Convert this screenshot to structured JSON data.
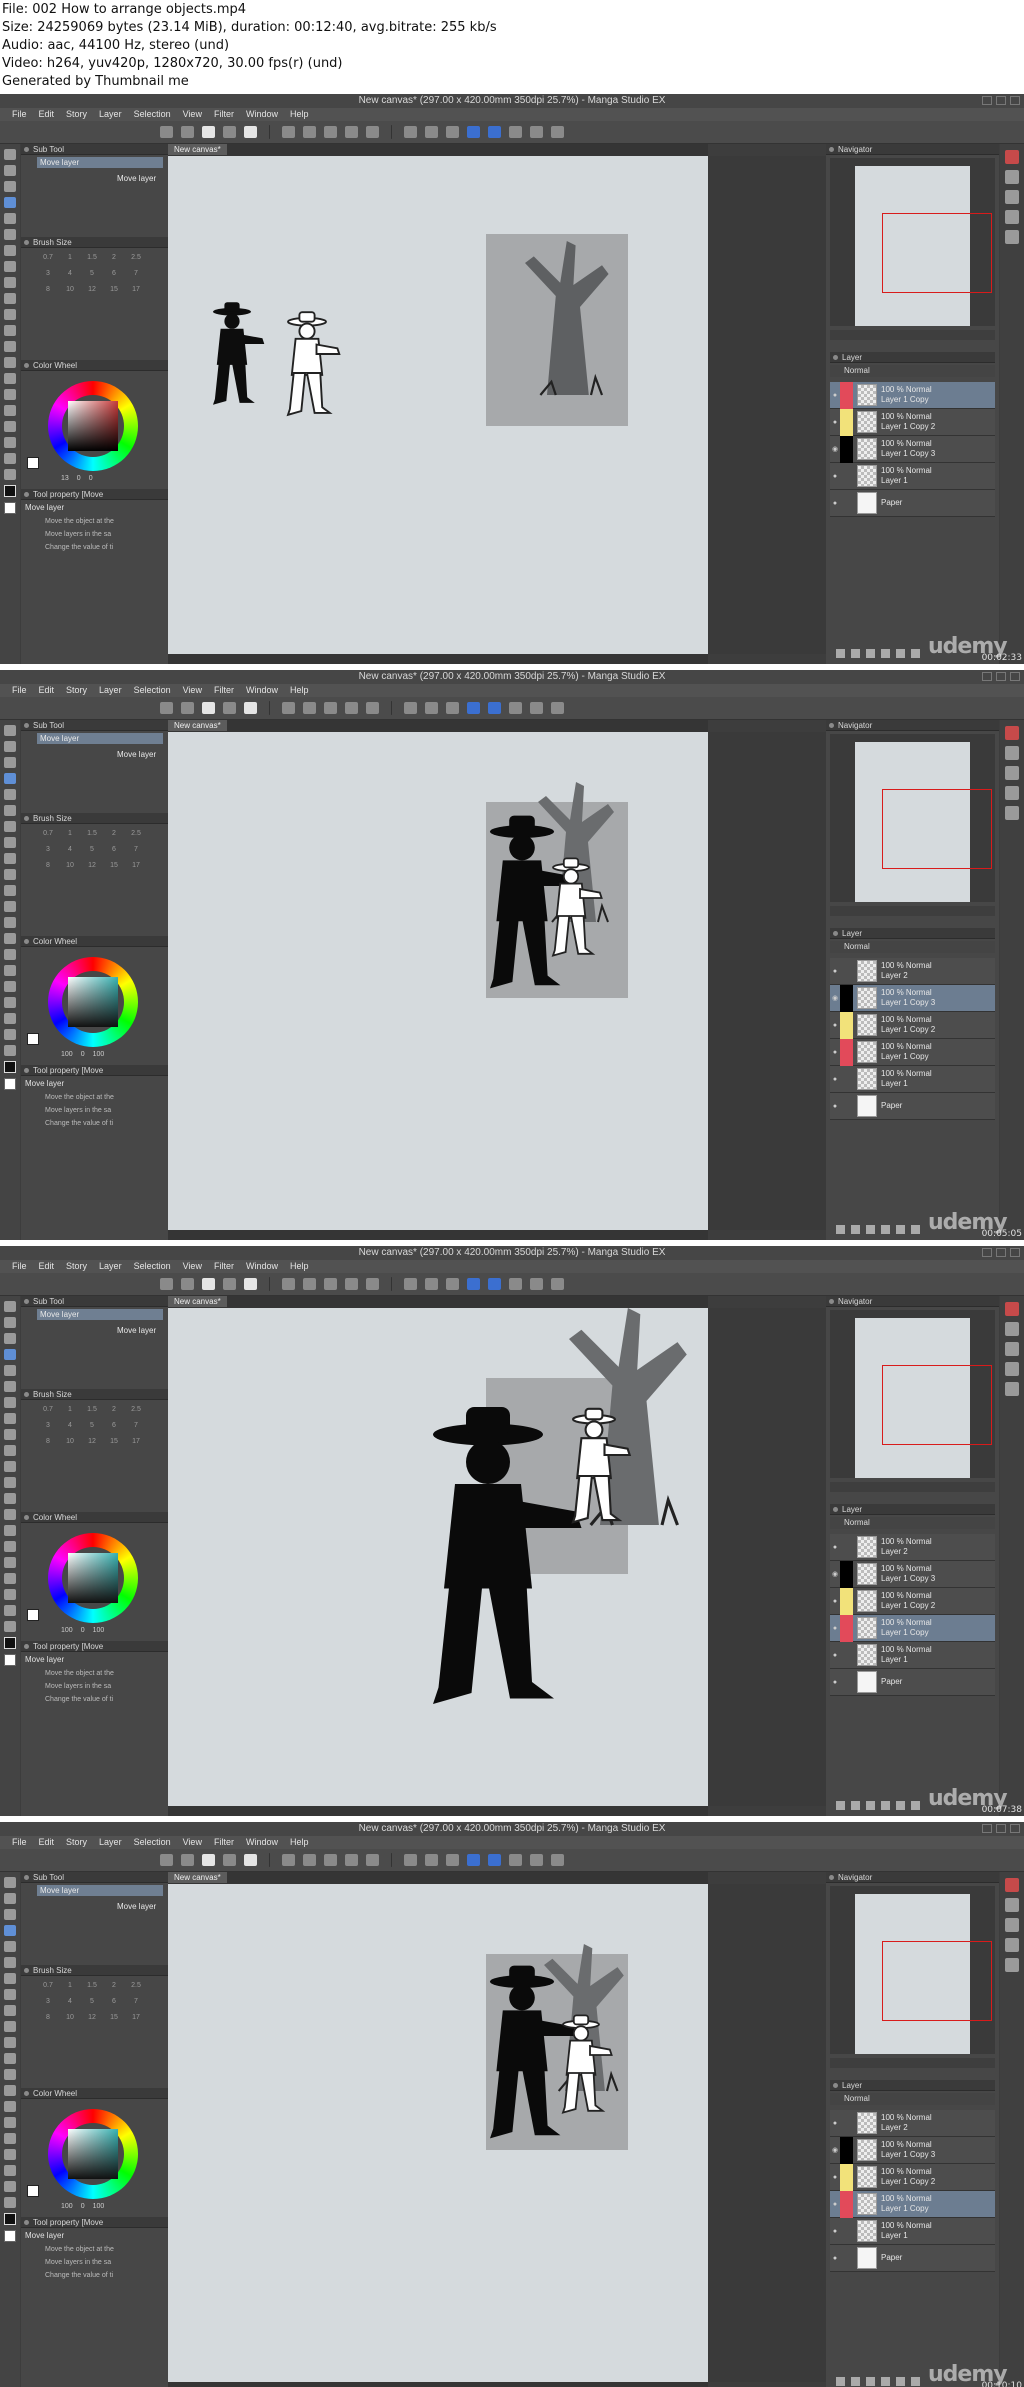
{
  "header": {
    "line1": "File: 002 How to arrange objects.mp4",
    "line2": "Size: 24259069 bytes (23.14 MiB), duration: 00:12:40, avg.bitrate: 255 kb/s",
    "line3": "Audio: aac, 44100 Hz, stereo (und)",
    "line4": "Video: h264, yuv420p, 1280x720, 30.00 fps(r) (und)",
    "line5": "Generated by Thumbnail me"
  },
  "app": {
    "title": "New canvas* (297.00 x 420.00mm 350dpi 25.7%) - Manga Studio EX",
    "menu": [
      "File",
      "Edit",
      "Story",
      "Layer",
      "Selection",
      "View",
      "Filter",
      "Window",
      "Help"
    ],
    "canvas_tab": "New canvas*",
    "panels": {
      "sub_tool": "Sub Tool",
      "sub_tool_item": "Move layer",
      "brush_size": "Brush Size",
      "color_wheel": "Color Wheel",
      "tool_property": "Tool property [Move",
      "tool_prop_name": "Move layer",
      "tool_opts": [
        "Move the object at the",
        "Move layers in the sa",
        "Change the value of ti"
      ],
      "navigator": "Navigator",
      "layer": "Layer",
      "blend_mode": "Normal"
    },
    "brush_sizes": [
      "0.7",
      "1",
      "1.5",
      "2",
      "2.5",
      "3",
      "4",
      "5",
      "6",
      "7",
      "8",
      "10",
      "12",
      "15",
      "17"
    ],
    "watermark": "udemy",
    "colors": {
      "selected_layer": "#6c7d91",
      "red_tag": "#e24a5a",
      "yellow_tag": "#f2e27a",
      "nav_frame": "#d81b1b"
    }
  },
  "frames": [
    {
      "timestamp": "00:02:33",
      "wheel_vals": [
        "13",
        "0",
        "0"
      ],
      "layers": [
        {
          "opacity": "100 % Normal",
          "name": "Layer 1 Copy",
          "tag": "red",
          "eye": "●",
          "sel": true
        },
        {
          "opacity": "100 % Normal",
          "name": "Layer 1 Copy 2",
          "tag": "yellow",
          "eye": "●",
          "sel": false
        },
        {
          "opacity": "100 % Normal",
          "name": "Layer 1 Copy 3",
          "tag": "black",
          "eye": "◉",
          "sel": false
        },
        {
          "opacity": "100 % Normal",
          "name": "Layer 1",
          "tag": "none",
          "eye": "●",
          "sel": false
        },
        {
          "opacity": "",
          "name": "Paper",
          "tag": "none",
          "eye": "●",
          "sel": false
        }
      ]
    },
    {
      "timestamp": "00:05:05",
      "wheel_vals": [
        "100",
        "0",
        "100"
      ],
      "layers": [
        {
          "opacity": "100 % Normal",
          "name": "Layer 2",
          "tag": "none",
          "eye": "●",
          "sel": false
        },
        {
          "opacity": "100 % Normal",
          "name": "Layer 1 Copy 3",
          "tag": "black",
          "eye": "◉",
          "sel": true
        },
        {
          "opacity": "100 % Normal",
          "name": "Layer 1 Copy 2",
          "tag": "yellow",
          "eye": "●",
          "sel": false
        },
        {
          "opacity": "100 % Normal",
          "name": "Layer 1 Copy",
          "tag": "red",
          "eye": "●",
          "sel": false
        },
        {
          "opacity": "100 % Normal",
          "name": "Layer 1",
          "tag": "none",
          "eye": "●",
          "sel": false
        },
        {
          "opacity": "",
          "name": "Paper",
          "tag": "none",
          "eye": "●",
          "sel": false
        }
      ]
    },
    {
      "timestamp": "00:07:38",
      "wheel_vals": [
        "100",
        "0",
        "100"
      ],
      "layers": [
        {
          "opacity": "100 % Normal",
          "name": "Layer 2",
          "tag": "none",
          "eye": "●",
          "sel": false
        },
        {
          "opacity": "100 % Normal",
          "name": "Layer 1 Copy 3",
          "tag": "black",
          "eye": "◉",
          "sel": false
        },
        {
          "opacity": "100 % Normal",
          "name": "Layer 1 Copy 2",
          "tag": "yellow",
          "eye": "●",
          "sel": false
        },
        {
          "opacity": "100 % Normal",
          "name": "Layer 1 Copy",
          "tag": "red",
          "eye": "●",
          "sel": true
        },
        {
          "opacity": "100 % Normal",
          "name": "Layer 1",
          "tag": "none",
          "eye": "●",
          "sel": false
        },
        {
          "opacity": "",
          "name": "Paper",
          "tag": "none",
          "eye": "●",
          "sel": false
        }
      ]
    },
    {
      "timestamp": "00:10:10",
      "wheel_vals": [
        "100",
        "0",
        "100"
      ],
      "layers": [
        {
          "opacity": "100 % Normal",
          "name": "Layer 2",
          "tag": "none",
          "eye": "●",
          "sel": false
        },
        {
          "opacity": "100 % Normal",
          "name": "Layer 1 Copy 3",
          "tag": "black",
          "eye": "◉",
          "sel": false
        },
        {
          "opacity": "100 % Normal",
          "name": "Layer 1 Copy 2",
          "tag": "yellow",
          "eye": "●",
          "sel": false
        },
        {
          "opacity": "100 % Normal",
          "name": "Layer 1 Copy",
          "tag": "red",
          "eye": "●",
          "sel": true
        },
        {
          "opacity": "100 % Normal",
          "name": "Layer 1",
          "tag": "none",
          "eye": "●",
          "sel": false
        },
        {
          "opacity": "",
          "name": "Paper",
          "tag": "none",
          "eye": "●",
          "sel": false
        }
      ]
    }
  ]
}
